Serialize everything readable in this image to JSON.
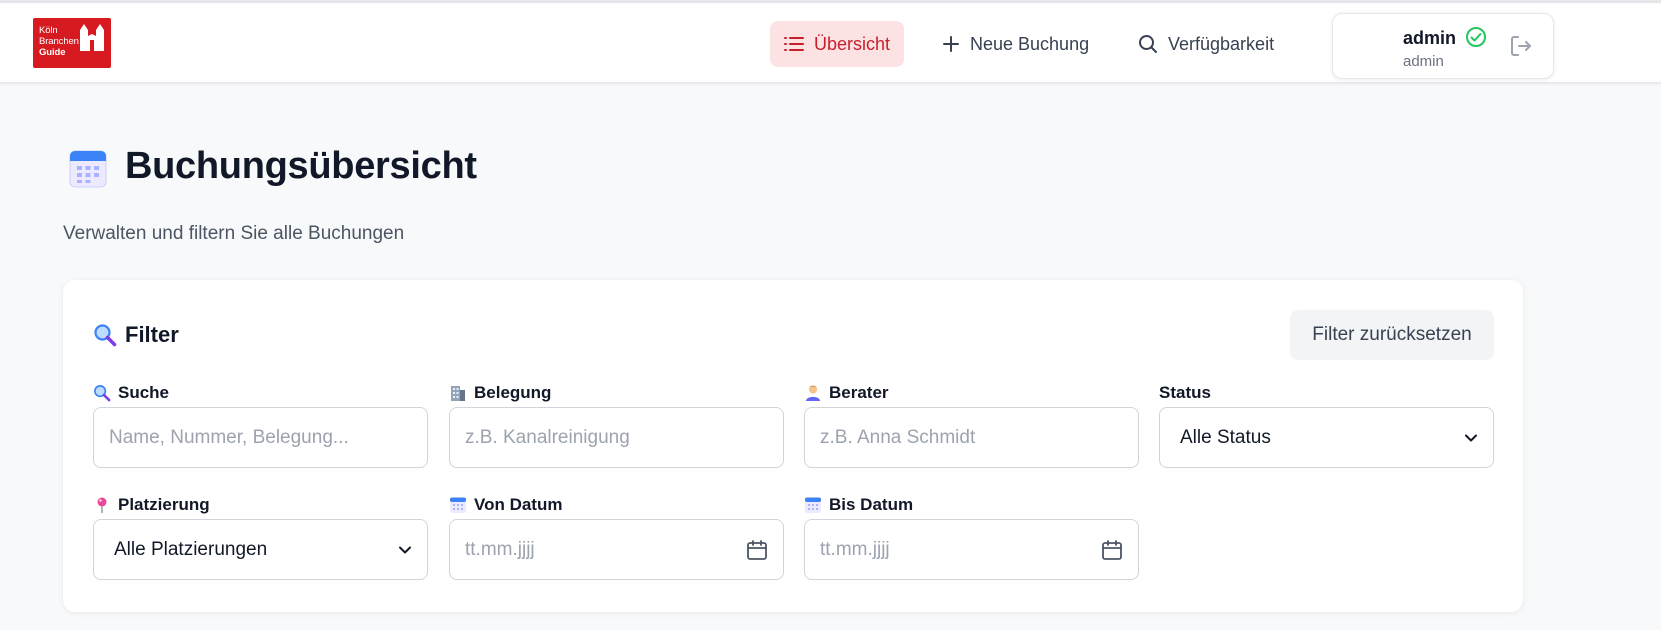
{
  "brand": {
    "logo_lines": [
      "Köln",
      "Branchen",
      "Guide"
    ],
    "color": "#d71920"
  },
  "nav": [
    {
      "label": "Übersicht",
      "icon": "list-icon",
      "active": true
    },
    {
      "label": "Neue Buchung",
      "icon": "plus-icon",
      "active": false
    },
    {
      "label": "Verfügbarkeit",
      "icon": "search-icon",
      "active": false
    }
  ],
  "user": {
    "name": "admin",
    "role": "admin",
    "status_icon": "check-circle-icon",
    "logout_icon": "logout-icon"
  },
  "page": {
    "icon": "calendar-icon",
    "title": "Buchungsübersicht",
    "subtitle": "Verwalten und filtern Sie alle Buchungen"
  },
  "filter": {
    "title_icon": "magnifier-icon",
    "title": "Filter",
    "reset_label": "Filter zurücksetzen",
    "fields": {
      "suche": {
        "icon": "magnifier-icon",
        "label": "Suche",
        "placeholder": "Name, Nummer, Belegung..."
      },
      "belegung": {
        "icon": "building-icon",
        "label": "Belegung",
        "placeholder": "z.B. Kanalreinigung"
      },
      "berater": {
        "icon": "person-icon",
        "label": "Berater",
        "placeholder": "z.B. Anna Schmidt"
      },
      "status": {
        "label": "Status",
        "selected": "Alle Status"
      },
      "platzierung": {
        "icon": "pin-icon",
        "label": "Platzierung",
        "selected": "Alle Platzierungen"
      },
      "von_datum": {
        "icon": "calendar-icon",
        "label": "Von Datum",
        "placeholder": "tt.mm.jjjj"
      },
      "bis_datum": {
        "icon": "calendar-icon",
        "label": "Bis Datum",
        "placeholder": "tt.mm.jjjj"
      }
    }
  },
  "colors": {
    "accent": "#c81e2b",
    "active_bg": "#fde2e4",
    "success": "#22c55e"
  }
}
